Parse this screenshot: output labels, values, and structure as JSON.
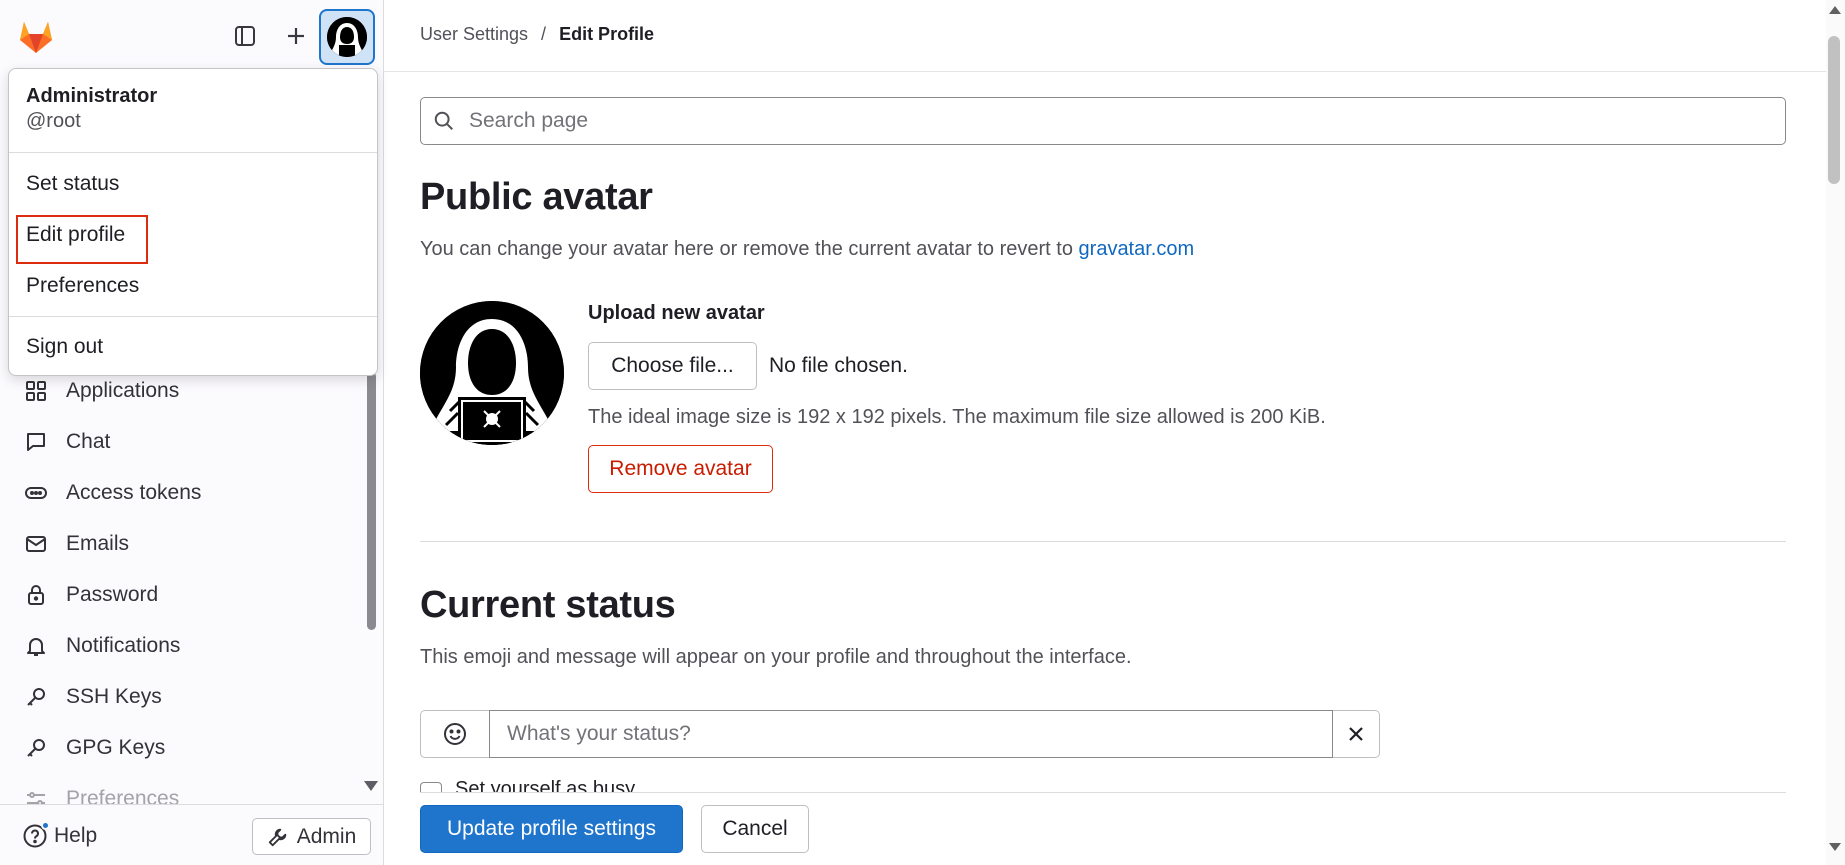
{
  "colors": {
    "primary": "#1f75cb",
    "danger": "#dd2b0e",
    "link": "#1068bf",
    "highlight_box": "#dd2b0e"
  },
  "sidebar": {
    "logo_icon": "gitlab-tanuki-icon",
    "toggle_icon": "sidebar-toggle-icon",
    "new_icon": "plus-icon",
    "nav_items": [
      {
        "label": "Applications",
        "icon": "applications-icon"
      },
      {
        "label": "Chat",
        "icon": "comment-icon"
      },
      {
        "label": "Access tokens",
        "icon": "token-icon"
      },
      {
        "label": "Emails",
        "icon": "mail-icon"
      },
      {
        "label": "Password",
        "icon": "lock-icon"
      },
      {
        "label": "Notifications",
        "icon": "bell-icon"
      },
      {
        "label": "SSH Keys",
        "icon": "key-icon"
      },
      {
        "label": "GPG Keys",
        "icon": "key-icon"
      },
      {
        "label": "Preferences",
        "icon": "preferences-icon"
      }
    ],
    "help_label": "Help",
    "admin_label": "Admin"
  },
  "user_menu": {
    "name": "Administrator",
    "handle": "@root",
    "items": {
      "set_status": "Set status",
      "edit_profile": "Edit profile",
      "preferences": "Preferences",
      "sign_out": "Sign out"
    }
  },
  "breadcrumb": {
    "parent": "User Settings",
    "separator": "/",
    "current": "Edit Profile"
  },
  "search": {
    "placeholder": "Search page",
    "value": ""
  },
  "avatar_section": {
    "title": "Public avatar",
    "description": "You can change your avatar here or remove the current avatar to revert to",
    "link_text": "gravatar.com",
    "upload_label": "Upload new avatar",
    "choose_button": "Choose file...",
    "no_file_text": "No file chosen.",
    "size_help": "The ideal image size is 192 x 192 pixels. The maximum file size allowed is 200 KiB.",
    "remove_button": "Remove avatar"
  },
  "status_section": {
    "title": "Current status",
    "description": "This emoji and message will appear on your profile and throughout the interface.",
    "input_placeholder": "What's your status?",
    "input_value": "",
    "busy_label": "Set yourself as busy"
  },
  "footer": {
    "update_button": "Update profile settings",
    "cancel_button": "Cancel"
  }
}
